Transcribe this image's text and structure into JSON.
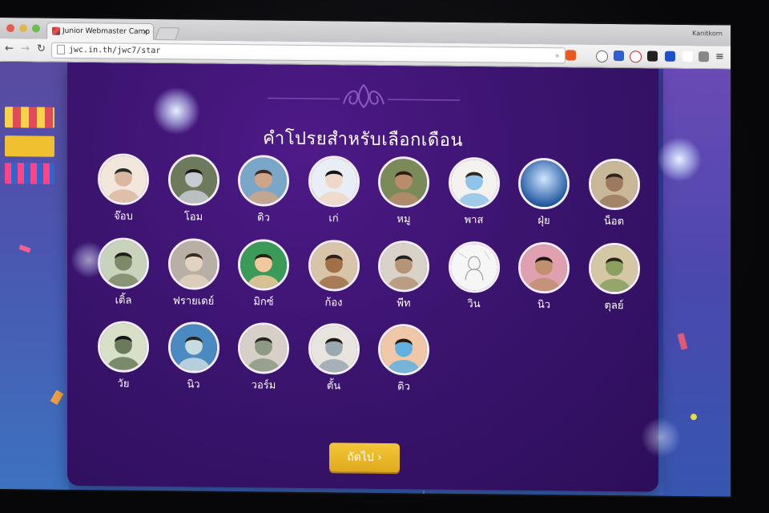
{
  "browser": {
    "tab_title": "Junior Webmaster Camp #",
    "tab_close": "×",
    "profile_name": "Kanitkorn",
    "url": "jwc.in.th/jwc7/star",
    "back": "←",
    "forward": "→",
    "reload": "↻",
    "star": "★",
    "menu": "≡"
  },
  "page": {
    "title": "คำโปรยสำหรับเลือกเดือน",
    "next_label": "ถัดไป",
    "next_chevron": "›"
  },
  "people": [
    {
      "name": "จ๊อบ",
      "photo": "profile-photo"
    },
    {
      "name": "โอม",
      "photo": "stormtrooper-photo"
    },
    {
      "name": "ดิว",
      "photo": "profile-photo"
    },
    {
      "name": "เก่",
      "photo": "profile-photo"
    },
    {
      "name": "หมู",
      "photo": "profile-photo"
    },
    {
      "name": "พาส",
      "photo": "profile-photo"
    },
    {
      "name": "ฝุ่ย",
      "photo": "sky-photo"
    },
    {
      "name": "น็อต",
      "photo": "profile-photo"
    },
    {
      "name": "เติ้ล",
      "photo": "profile-photo"
    },
    {
      "name": "ฟรายเดย์",
      "photo": "profile-photo"
    },
    {
      "name": "มิกซ์",
      "photo": "profile-photo"
    },
    {
      "name": "ก้อง",
      "photo": "profile-photo"
    },
    {
      "name": "พีท",
      "photo": "profile-photo"
    },
    {
      "name": "วิน",
      "photo": "sketch-photo"
    },
    {
      "name": "นิว",
      "photo": "profile-photo"
    },
    {
      "name": "ตุลย์",
      "photo": "profile-photo"
    },
    {
      "name": "วัย",
      "photo": "profile-photo"
    },
    {
      "name": "นิว",
      "photo": "profile-photo"
    },
    {
      "name": "วอร์ม",
      "photo": "profile-photo"
    },
    {
      "name": "ตั้น",
      "photo": "profile-photo"
    },
    {
      "name": "ดิว",
      "photo": "profile-photo"
    }
  ],
  "colors": {
    "panel": "#3b146f",
    "button": "#e8b52a",
    "avatar_border": "#f2eef8"
  }
}
